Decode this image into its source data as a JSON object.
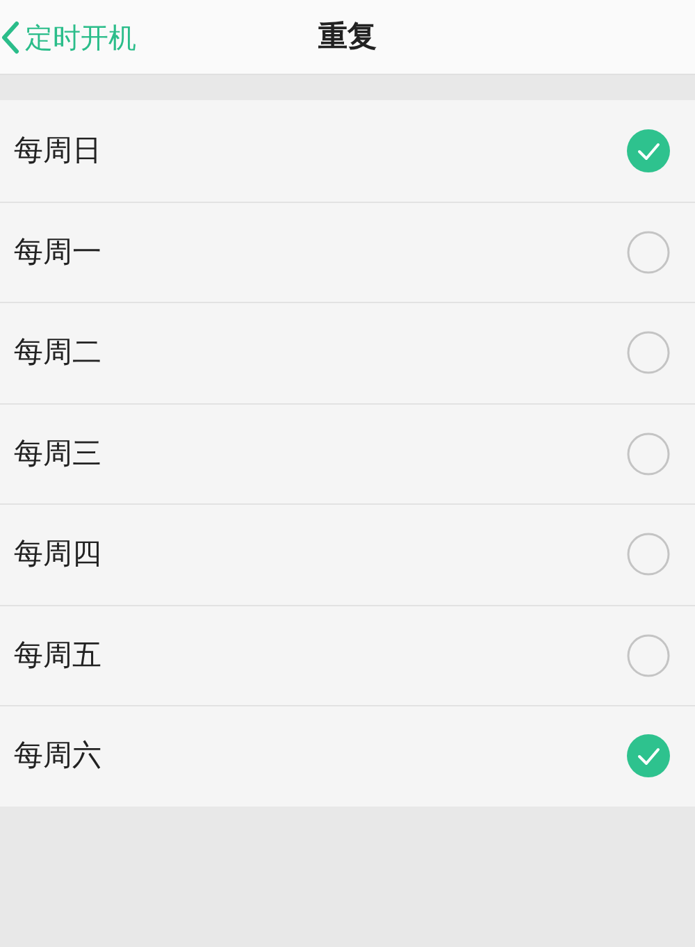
{
  "header": {
    "back_label": "定时开机",
    "title": "重复"
  },
  "days": [
    {
      "label": "每周日",
      "checked": true
    },
    {
      "label": "每周一",
      "checked": false
    },
    {
      "label": "每周二",
      "checked": false
    },
    {
      "label": "每周三",
      "checked": false
    },
    {
      "label": "每周四",
      "checked": false
    },
    {
      "label": "每周五",
      "checked": false
    },
    {
      "label": "每周六",
      "checked": true
    }
  ]
}
